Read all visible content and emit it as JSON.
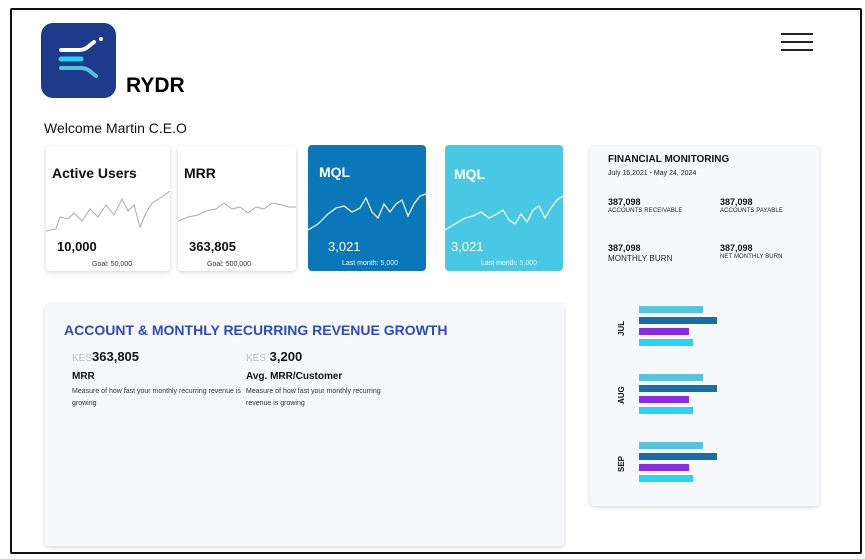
{
  "brand": {
    "name": "RYDR"
  },
  "welcome": "Welcome Martin C.E.O",
  "colors": {
    "logo_bg": "#1e3a8a",
    "card_dark": "#0a77b9",
    "card_light": "#49c8e3",
    "heading_blue": "#2c4ac4",
    "bar_1": "#55c4dc",
    "bar_2": "#176fa5",
    "bar_3": "#8b2be2",
    "bar_4": "#29d3f2"
  },
  "cards": [
    {
      "title": "Active Users",
      "value": "10,000",
      "goal": "Goal: 50,000"
    },
    {
      "title": "MRR",
      "value": "363,805",
      "goal": "Goal: 500,000"
    },
    {
      "title": "MQL",
      "value": "3,021",
      "goal_prefix": "Last month:",
      "goal_value": "5,000"
    },
    {
      "title": "MQL",
      "value": "3,021",
      "goal_prefix": "Last month:",
      "goal_value": "5,000"
    }
  ],
  "growth": {
    "title": "ACCOUNT & MONTHLY RECURRING REVENUE GROWTH",
    "metrics": [
      {
        "currency": "KES",
        "amount": "363,805",
        "label": "MRR",
        "desc": "Measure of how fast your monthly recurring revenue is growing"
      },
      {
        "currency": "KES",
        "amount": "3,200",
        "label": "Avg. MRR/Customer",
        "desc": "Measure of how fast your monthly recurring revenue is growing"
      }
    ]
  },
  "financial": {
    "title": "FINANCIAL MONITORING",
    "date_range": "July 16,2021 - May 24, 2024",
    "stats": [
      {
        "value": "387,098",
        "caption": "ACCOUNTS RECEIVABLE"
      },
      {
        "value": "387,098",
        "caption": "ACCOUNTS PAYABLE"
      },
      {
        "value": "387,098",
        "caption": "MONTHLY BURN"
      },
      {
        "value": "387,098",
        "caption": "NET MONTHLY BURN"
      }
    ],
    "months": [
      {
        "label": "JUL",
        "bars": [
          0.62,
          0.75,
          0.48,
          0.52
        ]
      },
      {
        "label": "AUG",
        "bars": [
          0.62,
          0.75,
          0.48,
          0.52
        ]
      },
      {
        "label": "SEP",
        "bars": [
          0.62,
          0.75,
          0.48,
          0.52
        ]
      }
    ]
  }
}
